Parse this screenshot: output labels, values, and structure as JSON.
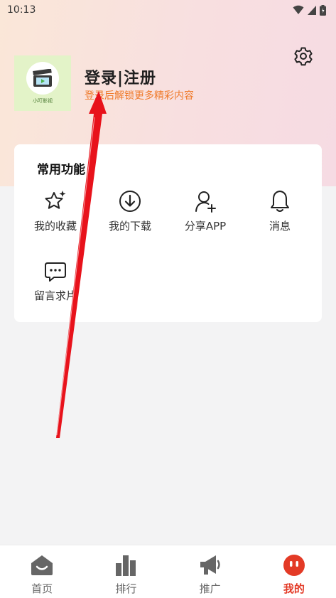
{
  "status_bar": {
    "time": "10:13"
  },
  "profile": {
    "login_title": "登录|注册",
    "login_subtitle": "登录后解锁更多精彩内容",
    "avatar_caption": "小叮影视",
    "accent": "#ef7a2a"
  },
  "features": {
    "section_title": "常用功能",
    "items": [
      {
        "label": "我的收藏",
        "icon": "star-sparkle-icon"
      },
      {
        "label": "我的下载",
        "icon": "download-icon"
      },
      {
        "label": "分享APP",
        "icon": "share-user-icon"
      },
      {
        "label": "消息",
        "icon": "bell-icon"
      },
      {
        "label": "留言求片",
        "icon": "message-icon"
      }
    ]
  },
  "bottom_nav": {
    "items": [
      {
        "label": "首页",
        "icon": "home-icon"
      },
      {
        "label": "排行",
        "icon": "ranking-icon"
      },
      {
        "label": "推广",
        "icon": "megaphone-icon"
      },
      {
        "label": "我的",
        "icon": "profile-face-icon",
        "active": true
      }
    ],
    "active_color": "#e33a26"
  }
}
